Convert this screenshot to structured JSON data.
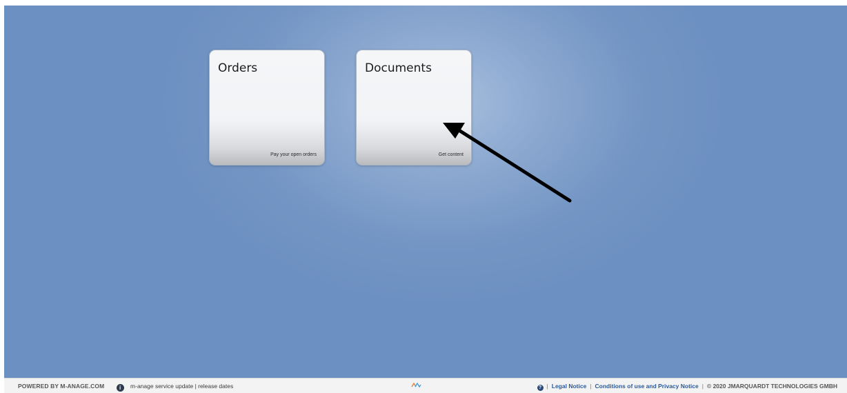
{
  "tiles": [
    {
      "title": "Orders",
      "subtitle": "Pay your open orders"
    },
    {
      "title": "Documents",
      "subtitle": "Get content"
    }
  ],
  "footer": {
    "powered_by": "POWERED BY M-ANAGE.COM",
    "info_icon": "info-icon",
    "service_update": "m-anage service update | release dates",
    "logo_icon": "m-anage-wave-icon",
    "help_icon": "question-icon",
    "legal_notice": "Legal Notice",
    "conditions": "Conditions of use and Privacy Notice",
    "copyright": "© 2020 JMARQUARDT TECHNOLOGIES GMBH"
  },
  "colors": {
    "background": "#7395c4",
    "background_center": "#a8bfdd",
    "tile": "#f1f3f6",
    "footer_link": "#2b5a9a",
    "arrow": "#000000"
  }
}
